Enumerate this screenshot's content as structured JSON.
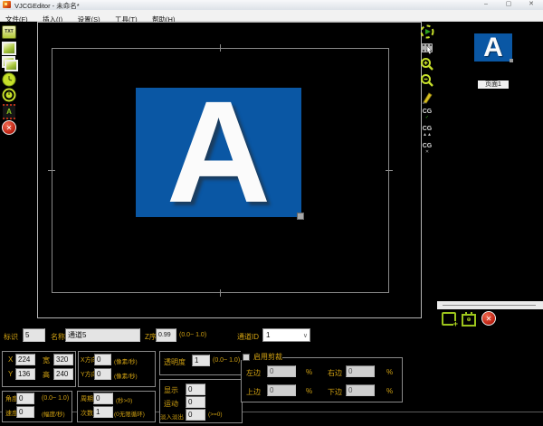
{
  "title_bar": {
    "title": "VJCGEditor - 未命名*",
    "minimize_glyph": "–",
    "maximize_glyph": "▢",
    "close_glyph": "✕"
  },
  "menu": {
    "items": [
      "文件(F)",
      "插入(I)",
      "设置(S)",
      "工具(T)",
      "帮助(H)"
    ]
  },
  "left_toolbar": {
    "txt_label": "TXT",
    "marquee_letter": "A",
    "delete_glyph": "✕"
  },
  "canvas": {
    "image_letter": "A"
  },
  "right_panel": {
    "cg_label": "CG",
    "check_glyph": "✓",
    "up_glyph": "▲▲",
    "x_glyph": "✕",
    "page_thumb_letter": "A",
    "page_label": "页面1",
    "add_page_glyph": "+",
    "send_page_glyph": "⊕",
    "delete_glyph": "✕"
  },
  "properties": {
    "row1": {
      "id_label": "标识",
      "id_value": "5",
      "name_label": "名称",
      "name_value": "通道5",
      "z_label": "Z序",
      "z_value": "0.99",
      "z_hint": "(0.0~ 1.0)",
      "channel_label": "通道ID",
      "channel_value": "1",
      "channel_chevron": "∨"
    },
    "position": {
      "x_label": "X",
      "x_value": "224",
      "width_label": "宽",
      "width_value": "320",
      "y_label": "Y",
      "y_value": "136",
      "height_label": "高",
      "height_value": "240"
    },
    "direction": {
      "x_label": "X方向",
      "x_value": "0",
      "y_label": "Y方向",
      "y_value": "0",
      "unit_hint": "(像素/秒)"
    },
    "opacity": {
      "label": "透明度",
      "value": "1",
      "hint": "(0.0~ 1.0)"
    },
    "timing": {
      "show_label": "显示",
      "show_value": "0",
      "move_label": "运动",
      "move_value": "0",
      "fade_label": "淡入淡出",
      "fade_value": "0",
      "fade_hint": "(>=0)"
    },
    "rotation": {
      "angle_label": "角度",
      "angle_value": "0",
      "angle_hint": "(0.0~ 1.0)",
      "speed_label": "速度",
      "speed_value": "0",
      "speed_hint": "(幅度/秒)"
    },
    "loop": {
      "period_label": "周期",
      "period_value": "0",
      "period_hint": "(秒>0)",
      "count_label": "次数",
      "count_value": "1",
      "count_hint": "(0无限循环)"
    },
    "crop": {
      "title": "启用剪裁",
      "left_label": "左边",
      "left_value": "0",
      "right_label": "右边",
      "right_value": "0",
      "top_label": "上边",
      "top_value": "0",
      "bottom_label": "下边",
      "bottom_value": "0",
      "percent": "%"
    }
  },
  "colors": {
    "accent_green": "#b8d41e",
    "label_orange": "#d2a212",
    "image_blue": "#0a57a4",
    "delete_red": "#c02414"
  }
}
